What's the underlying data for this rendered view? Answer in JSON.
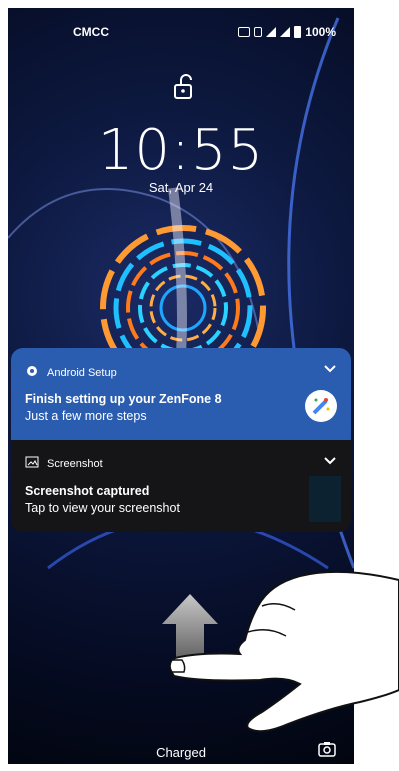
{
  "status": {
    "carrier": "CMCC",
    "battery": "100%"
  },
  "lock": {
    "time": "10:55",
    "date": "Sat, Apr 24"
  },
  "notifications": [
    {
      "app": "Android Setup",
      "title": "Finish setting up your ZenFone 8",
      "text": "Just a few more steps",
      "icon": "gear-icon",
      "color": "#2a5db0"
    },
    {
      "app": "Screenshot",
      "title": "Screenshot captured",
      "text": "Tap to view your screenshot",
      "icon": "image-icon"
    }
  ],
  "footer": {
    "status": "Charged",
    "shortcut_icon": "camera-icon"
  }
}
